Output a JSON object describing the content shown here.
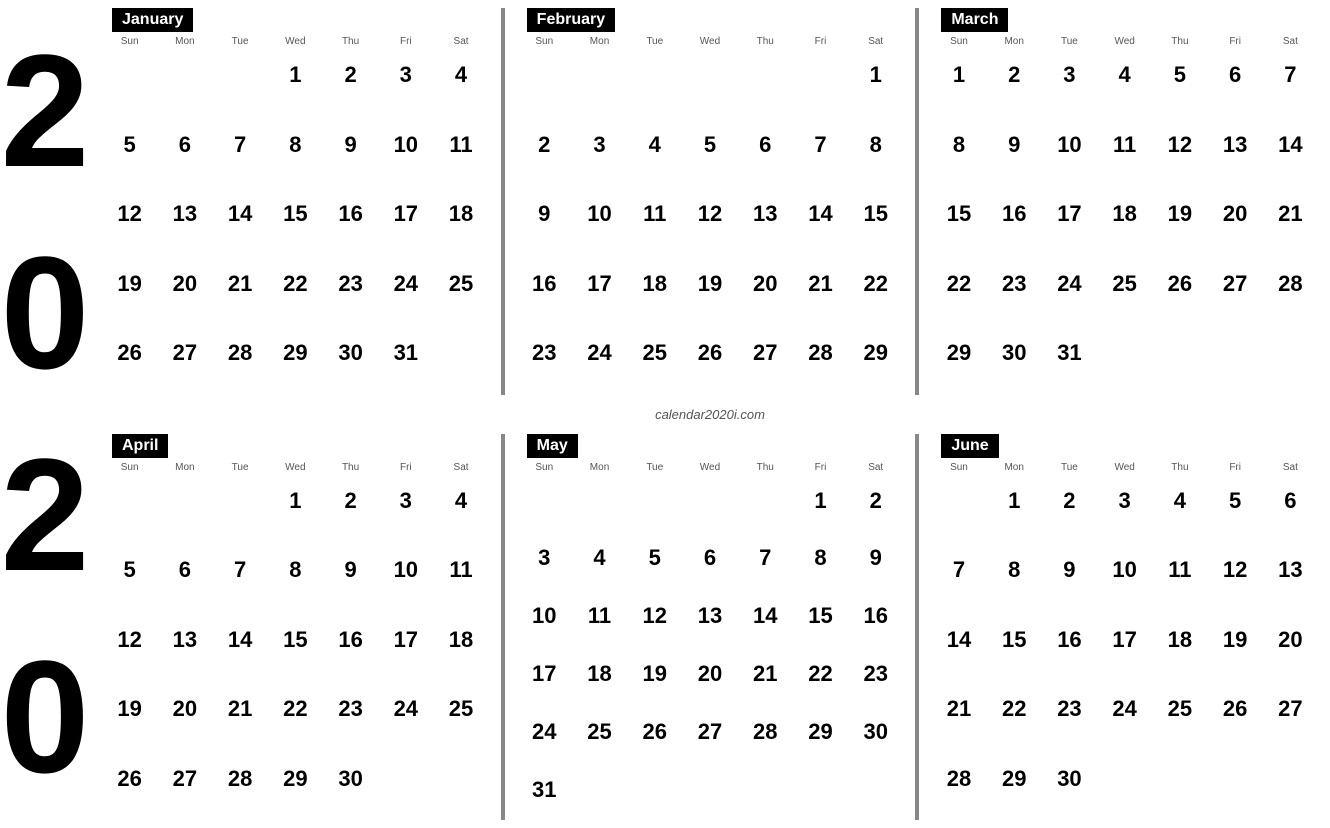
{
  "year": {
    "digits": [
      "2",
      "0",
      "2",
      "0"
    ]
  },
  "watermark": "calendar2020i.com",
  "months": [
    {
      "name": "January",
      "startDay": 3,
      "days": 31,
      "dow": [
        "Sun",
        "Mon",
        "Tue",
        "Wed",
        "Thu",
        "Fri",
        "Sat"
      ]
    },
    {
      "name": "February",
      "startDay": 6,
      "days": 29,
      "dow": [
        "Sun",
        "Mon",
        "Tue",
        "Wed",
        "Thu",
        "Fri",
        "Sat"
      ]
    },
    {
      "name": "March",
      "startDay": 0,
      "days": 31,
      "dow": [
        "Sun",
        "Mon",
        "Tue",
        "Wed",
        "Thu",
        "Fri",
        "Sat"
      ]
    },
    {
      "name": "April",
      "startDay": 3,
      "days": 30,
      "dow": [
        "Sun",
        "Mon",
        "Tue",
        "Wed",
        "Thu",
        "Fri",
        "Sat"
      ]
    },
    {
      "name": "May",
      "startDay": 5,
      "days": 31,
      "dow": [
        "Sun",
        "Mon",
        "Tue",
        "Wed",
        "Thu",
        "Fri",
        "Sat"
      ]
    },
    {
      "name": "June",
      "startDay": 1,
      "days": 30,
      "dow": [
        "Sun",
        "Mon",
        "Tue",
        "Wed",
        "Thu",
        "Fri",
        "Sat"
      ]
    }
  ]
}
